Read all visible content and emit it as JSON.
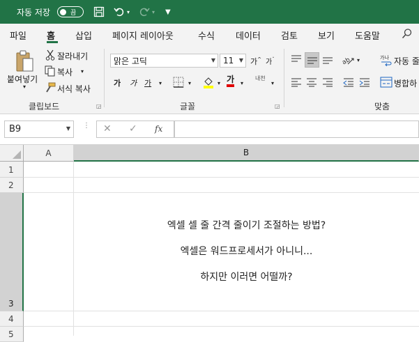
{
  "titlebar": {
    "autosave_label": "자동 저장",
    "autosave_state": "끔",
    "bg_color": "#217346"
  },
  "ribbon_tabs": [
    "파일",
    "홈",
    "삽입",
    "페이지 레이아웃",
    "수식",
    "데이터",
    "검토",
    "보기",
    "도움말"
  ],
  "active_tab": "홈",
  "clipboard": {
    "paste_label": "붙여넣기",
    "cut_label": "잘라내기",
    "copy_label": "복사",
    "format_painter_label": "서식 복사",
    "group_label": "클립보드"
  },
  "font": {
    "font_name": "맑은 고딕",
    "font_size": "11",
    "bold_glyph": "가",
    "italic_glyph": "가",
    "underline_glyph": "가",
    "font_color_glyph": "가",
    "phonetic_glyph": "내천",
    "group_label": "글꼴",
    "font_color": "#ff0000",
    "highlight_color": "#ffff00"
  },
  "alignment": {
    "wrap_text_label": "자동 줄",
    "merge_label": "병합하",
    "group_label": "맞춤"
  },
  "formula_bar": {
    "name_box": "B9",
    "fx_label": "fx",
    "value": ""
  },
  "sheet": {
    "columns": [
      "A",
      "B"
    ],
    "rows": [
      "1",
      "2",
      "3",
      "4",
      "5"
    ],
    "selected_column": "B",
    "selected_row": "3",
    "cell_b3_lines": [
      "엑셀 셀 줄 간격 줄이기 조절하는 방법?",
      "엑셀은 워드프로세서가 아니니...",
      "하지만 이러면 어떨까?"
    ]
  }
}
